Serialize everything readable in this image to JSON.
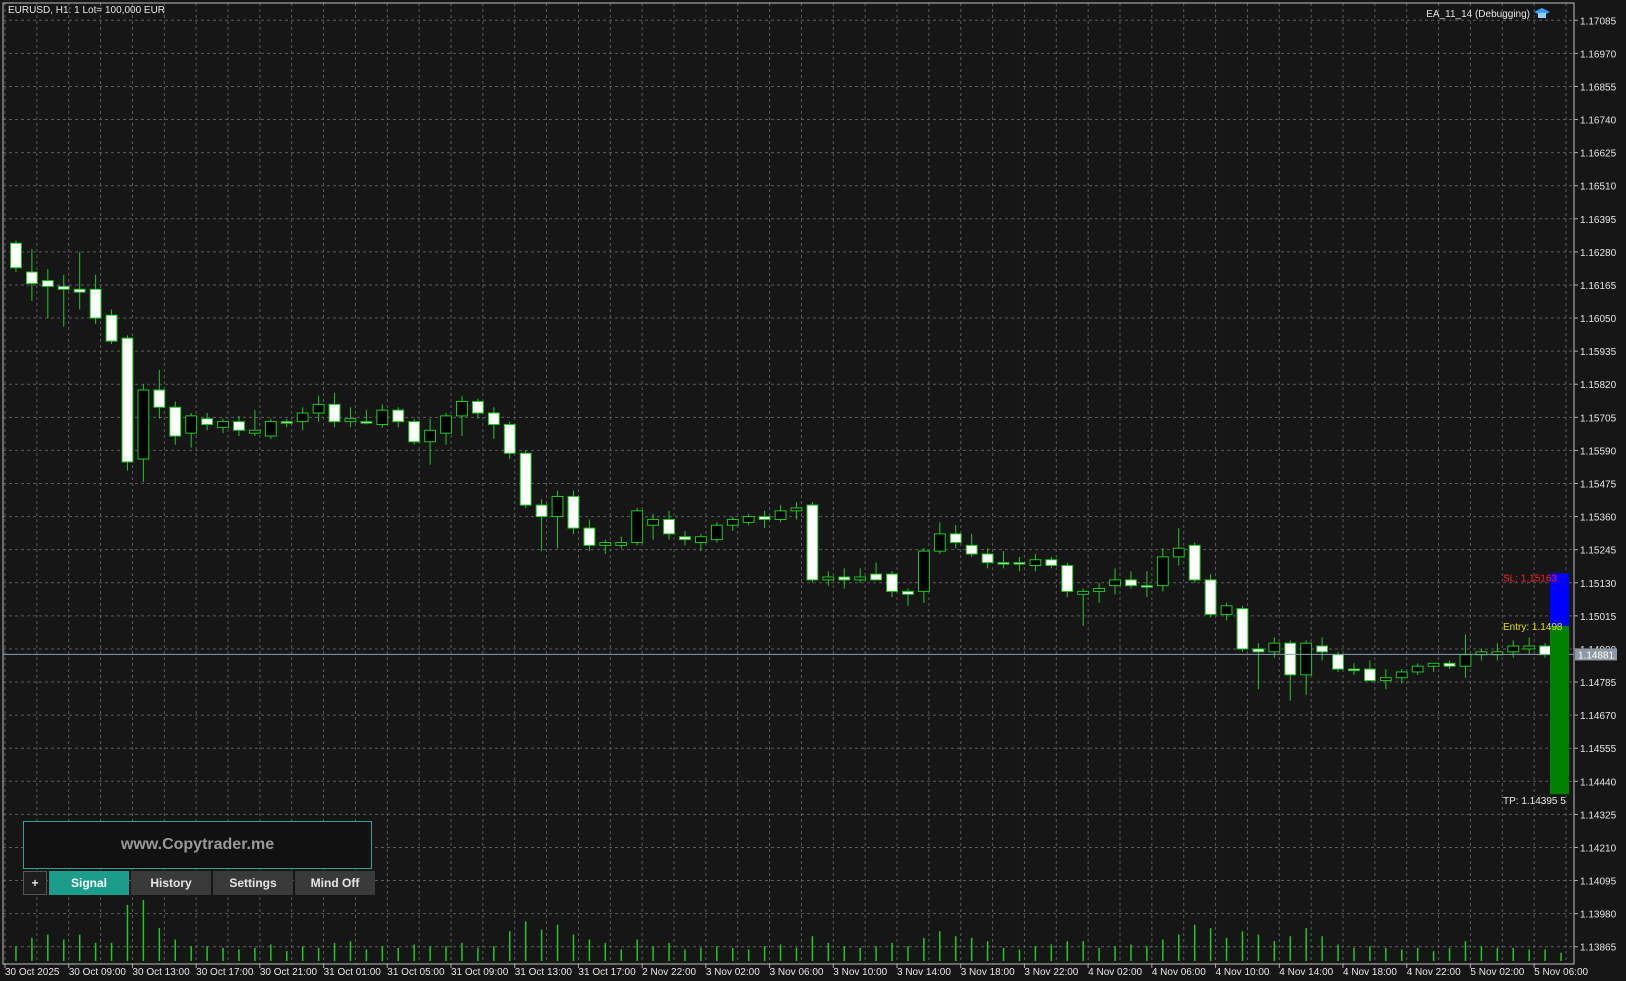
{
  "header": {
    "symbol_info": "EURUSD, H1:  1 Lot= 100,000 EUR",
    "ea_label": "EA_11_14 (Debugging)",
    "ea_icon": "graduation-cap-icon"
  },
  "panel": {
    "title": "www.Copytrader.me",
    "buttons": {
      "plus": "+",
      "signal": "Signal",
      "history": "History",
      "settings": "Settings",
      "mind": "Mind Off"
    }
  },
  "trade": {
    "sl_label": "SL: 1.15163",
    "entry_label": "Entry: 1.1498",
    "tp_label": "TP: 1.14395 5",
    "current_price_label": "1.14881",
    "sl": 1.15163,
    "entry": 1.1498,
    "tp": 1.14395,
    "current_price": 1.14881
  },
  "colors": {
    "background": "#161616",
    "grid": "#5b5b5b",
    "bull_candle": "#000000",
    "bear_candle": "#ffffff",
    "wick": "#22c722",
    "volume": "#22c722",
    "panel_border": "#2fa38f",
    "signal_button": "#1a9d8a",
    "sl_box": "#0000ff",
    "tp_box": "#008000",
    "sl_text": "#ff2020",
    "entry_text": "#e0e000",
    "tp_text": "#e6e6e6",
    "price_line": "#8aa0b0"
  },
  "chart_data": {
    "type": "candlestick",
    "timeframe": "H1",
    "y_ticks": [
      "1.17085",
      "1.16970",
      "1.16855",
      "1.16740",
      "1.16625",
      "1.16510",
      "1.16395",
      "1.16280",
      "1.16165",
      "1.16050",
      "1.15935",
      "1.15820",
      "1.15705",
      "1.15590",
      "1.15475",
      "1.15360",
      "1.15245",
      "1.15130",
      "1.15015",
      "1.14900",
      "1.14785",
      "1.14670",
      "1.14555",
      "1.14440",
      "1.14325",
      "1.14210",
      "1.14095",
      "1.13980",
      "1.13865"
    ],
    "ylim": [
      1.13805,
      1.17145
    ],
    "x_ticks": [
      "30 Oct 2025",
      "30 Oct 09:00",
      "30 Oct 13:00",
      "30 Oct 17:00",
      "30 Oct 21:00",
      "31 Oct 01:00",
      "31 Oct 05:00",
      "31 Oct 09:00",
      "31 Oct 13:00",
      "31 Oct 17:00",
      "2 Nov 22:00",
      "3 Nov 02:00",
      "3 Nov 06:00",
      "3 Nov 10:00",
      "3 Nov 14:00",
      "3 Nov 18:00",
      "3 Nov 22:00",
      "4 Nov 02:00",
      "4 Nov 06:00",
      "4 Nov 10:00",
      "4 Nov 14:00",
      "4 Nov 18:00",
      "4 Nov 22:00",
      "5 Nov 02:00",
      "5 Nov 06:00"
    ],
    "candles": [
      {
        "o": 1.1631,
        "h": 1.1632,
        "l": 1.1621,
        "c": 1.16225,
        "v": 9
      },
      {
        "o": 1.1621,
        "h": 1.1629,
        "l": 1.1611,
        "c": 1.1617,
        "v": 14
      },
      {
        "o": 1.1618,
        "h": 1.1622,
        "l": 1.1605,
        "c": 1.1616,
        "v": 16
      },
      {
        "o": 1.1616,
        "h": 1.162,
        "l": 1.1602,
        "c": 1.1615,
        "v": 13
      },
      {
        "o": 1.1615,
        "h": 1.1628,
        "l": 1.1608,
        "c": 1.1614,
        "v": 16
      },
      {
        "o": 1.1615,
        "h": 1.162,
        "l": 1.1603,
        "c": 1.1605,
        "v": 11
      },
      {
        "o": 1.1606,
        "h": 1.1608,
        "l": 1.1596,
        "c": 1.1597,
        "v": 11
      },
      {
        "o": 1.1598,
        "h": 1.1599,
        "l": 1.1552,
        "c": 1.1555,
        "v": 34
      },
      {
        "o": 1.1556,
        "h": 1.1582,
        "l": 1.1548,
        "c": 1.158,
        "v": 37
      },
      {
        "o": 1.158,
        "h": 1.1587,
        "l": 1.157,
        "c": 1.1574,
        "v": 20
      },
      {
        "o": 1.1574,
        "h": 1.1576,
        "l": 1.1561,
        "c": 1.1564,
        "v": 13
      },
      {
        "o": 1.1565,
        "h": 1.1572,
        "l": 1.156,
        "c": 1.1571,
        "v": 9
      },
      {
        "o": 1.157,
        "h": 1.1572,
        "l": 1.1566,
        "c": 1.1568,
        "v": 9
      },
      {
        "o": 1.1567,
        "h": 1.157,
        "l": 1.1565,
        "c": 1.1569,
        "v": 8
      },
      {
        "o": 1.1569,
        "h": 1.1571,
        "l": 1.1564,
        "c": 1.1566,
        "v": 7
      },
      {
        "o": 1.1565,
        "h": 1.1573,
        "l": 1.1564,
        "c": 1.1566,
        "v": 8
      },
      {
        "o": 1.1564,
        "h": 1.157,
        "l": 1.1563,
        "c": 1.1569,
        "v": 10
      },
      {
        "o": 1.1569,
        "h": 1.157,
        "l": 1.1567,
        "c": 1.1569,
        "v": 6
      },
      {
        "o": 1.1569,
        "h": 1.1574,
        "l": 1.1566,
        "c": 1.1572,
        "v": 9
      },
      {
        "o": 1.1572,
        "h": 1.1578,
        "l": 1.1569,
        "c": 1.1575,
        "v": 8
      },
      {
        "o": 1.1575,
        "h": 1.1579,
        "l": 1.1567,
        "c": 1.1569,
        "v": 11
      },
      {
        "o": 1.1569,
        "h": 1.1574,
        "l": 1.1567,
        "c": 1.157,
        "v": 12
      },
      {
        "o": 1.1569,
        "h": 1.1573,
        "l": 1.1568,
        "c": 1.1569,
        "v": 7
      },
      {
        "o": 1.1568,
        "h": 1.1575,
        "l": 1.1567,
        "c": 1.1573,
        "v": 9
      },
      {
        "o": 1.1573,
        "h": 1.1574,
        "l": 1.1567,
        "c": 1.1569,
        "v": 8
      },
      {
        "o": 1.1569,
        "h": 1.157,
        "l": 1.1561,
        "c": 1.1562,
        "v": 10
      },
      {
        "o": 1.1562,
        "h": 1.157,
        "l": 1.1554,
        "c": 1.1566,
        "v": 9
      },
      {
        "o": 1.1565,
        "h": 1.1572,
        "l": 1.1561,
        "c": 1.1571,
        "v": 9
      },
      {
        "o": 1.1571,
        "h": 1.1578,
        "l": 1.1564,
        "c": 1.1576,
        "v": 11
      },
      {
        "o": 1.1576,
        "h": 1.1577,
        "l": 1.157,
        "c": 1.1572,
        "v": 8
      },
      {
        "o": 1.1572,
        "h": 1.1574,
        "l": 1.1563,
        "c": 1.1568,
        "v": 9
      },
      {
        "o": 1.1568,
        "h": 1.1569,
        "l": 1.1556,
        "c": 1.1558,
        "v": 18
      },
      {
        "o": 1.1558,
        "h": 1.1559,
        "l": 1.1539,
        "c": 1.154,
        "v": 24
      },
      {
        "o": 1.154,
        "h": 1.1542,
        "l": 1.1524,
        "c": 1.1536,
        "v": 19
      },
      {
        "o": 1.1536,
        "h": 1.1545,
        "l": 1.1525,
        "c": 1.1543,
        "v": 22
      },
      {
        "o": 1.1543,
        "h": 1.1545,
        "l": 1.153,
        "c": 1.1532,
        "v": 16
      },
      {
        "o": 1.1532,
        "h": 1.1535,
        "l": 1.1524,
        "c": 1.1526,
        "v": 13
      },
      {
        "o": 1.1526,
        "h": 1.1528,
        "l": 1.1523,
        "c": 1.1527,
        "v": 11
      },
      {
        "o": 1.1526,
        "h": 1.1529,
        "l": 1.1525,
        "c": 1.1527,
        "v": 7
      },
      {
        "o": 1.1527,
        "h": 1.1539,
        "l": 1.1526,
        "c": 1.1538,
        "v": 13
      },
      {
        "o": 1.1533,
        "h": 1.1537,
        "l": 1.1528,
        "c": 1.1535,
        "v": 9
      },
      {
        "o": 1.1535,
        "h": 1.1538,
        "l": 1.1528,
        "c": 1.153,
        "v": 11
      },
      {
        "o": 1.1529,
        "h": 1.1531,
        "l": 1.1526,
        "c": 1.1528,
        "v": 7
      },
      {
        "o": 1.1527,
        "h": 1.153,
        "l": 1.1524,
        "c": 1.1529,
        "v": 8
      },
      {
        "o": 1.1528,
        "h": 1.1534,
        "l": 1.1527,
        "c": 1.1533,
        "v": 9
      },
      {
        "o": 1.1533,
        "h": 1.1536,
        "l": 1.1531,
        "c": 1.1535,
        "v": 8
      },
      {
        "o": 1.1534,
        "h": 1.1537,
        "l": 1.1533,
        "c": 1.1536,
        "v": 7
      },
      {
        "o": 1.1536,
        "h": 1.1538,
        "l": 1.1532,
        "c": 1.1535,
        "v": 9
      },
      {
        "o": 1.1535,
        "h": 1.154,
        "l": 1.1534,
        "c": 1.1538,
        "v": 10
      },
      {
        "o": 1.1538,
        "h": 1.1541,
        "l": 1.1535,
        "c": 1.1539,
        "v": 8
      },
      {
        "o": 1.154,
        "h": 1.1541,
        "l": 1.1513,
        "c": 1.1514,
        "v": 15
      },
      {
        "o": 1.1514,
        "h": 1.1517,
        "l": 1.1512,
        "c": 1.1515,
        "v": 11
      },
      {
        "o": 1.1515,
        "h": 1.1518,
        "l": 1.1511,
        "c": 1.1514,
        "v": 9
      },
      {
        "o": 1.1514,
        "h": 1.1518,
        "l": 1.1513,
        "c": 1.1515,
        "v": 8
      },
      {
        "o": 1.1516,
        "h": 1.152,
        "l": 1.1514,
        "c": 1.1514,
        "v": 9
      },
      {
        "o": 1.1516,
        "h": 1.1517,
        "l": 1.1508,
        "c": 1.151,
        "v": 11
      },
      {
        "o": 1.151,
        "h": 1.1511,
        "l": 1.1505,
        "c": 1.1509,
        "v": 9
      },
      {
        "o": 1.151,
        "h": 1.1525,
        "l": 1.1506,
        "c": 1.1524,
        "v": 14
      },
      {
        "o": 1.1524,
        "h": 1.1534,
        "l": 1.1523,
        "c": 1.153,
        "v": 18
      },
      {
        "o": 1.153,
        "h": 1.1533,
        "l": 1.1525,
        "c": 1.1527,
        "v": 15
      },
      {
        "o": 1.1526,
        "h": 1.153,
        "l": 1.1522,
        "c": 1.1523,
        "v": 14
      },
      {
        "o": 1.1523,
        "h": 1.1525,
        "l": 1.1518,
        "c": 1.152,
        "v": 12
      },
      {
        "o": 1.152,
        "h": 1.1524,
        "l": 1.1518,
        "c": 1.152,
        "v": 8
      },
      {
        "o": 1.152,
        "h": 1.1522,
        "l": 1.1517,
        "c": 1.152,
        "v": 7
      },
      {
        "o": 1.1519,
        "h": 1.1523,
        "l": 1.1517,
        "c": 1.1521,
        "v": 9
      },
      {
        "o": 1.1521,
        "h": 1.1522,
        "l": 1.1518,
        "c": 1.1519,
        "v": 10
      },
      {
        "o": 1.1519,
        "h": 1.152,
        "l": 1.1508,
        "c": 1.151,
        "v": 12
      },
      {
        "o": 1.1509,
        "h": 1.1511,
        "l": 1.1498,
        "c": 1.151,
        "v": 12
      },
      {
        "o": 1.151,
        "h": 1.1513,
        "l": 1.1506,
        "c": 1.1511,
        "v": 8
      },
      {
        "o": 1.1512,
        "h": 1.1518,
        "l": 1.1509,
        "c": 1.1514,
        "v": 9
      },
      {
        "o": 1.1514,
        "h": 1.1517,
        "l": 1.1511,
        "c": 1.1512,
        "v": 10
      },
      {
        "o": 1.1512,
        "h": 1.1517,
        "l": 1.1508,
        "c": 1.1512,
        "v": 9
      },
      {
        "o": 1.1512,
        "h": 1.1525,
        "l": 1.151,
        "c": 1.1522,
        "v": 13
      },
      {
        "o": 1.1522,
        "h": 1.1532,
        "l": 1.1519,
        "c": 1.1525,
        "v": 16
      },
      {
        "o": 1.1526,
        "h": 1.1527,
        "l": 1.1513,
        "c": 1.1514,
        "v": 22
      },
      {
        "o": 1.1514,
        "h": 1.1516,
        "l": 1.1501,
        "c": 1.1502,
        "v": 20
      },
      {
        "o": 1.1502,
        "h": 1.1506,
        "l": 1.15,
        "c": 1.1505,
        "v": 14
      },
      {
        "o": 1.1504,
        "h": 1.1505,
        "l": 1.1489,
        "c": 1.149,
        "v": 18
      },
      {
        "o": 1.149,
        "h": 1.1492,
        "l": 1.1476,
        "c": 1.1489,
        "v": 16
      },
      {
        "o": 1.1489,
        "h": 1.1494,
        "l": 1.1487,
        "c": 1.1492,
        "v": 12
      },
      {
        "o": 1.1492,
        "h": 1.1493,
        "l": 1.1472,
        "c": 1.1481,
        "v": 15
      },
      {
        "o": 1.1481,
        "h": 1.1493,
        "l": 1.1474,
        "c": 1.1492,
        "v": 20
      },
      {
        "o": 1.1491,
        "h": 1.1494,
        "l": 1.1486,
        "c": 1.1489,
        "v": 15
      },
      {
        "o": 1.1488,
        "h": 1.1489,
        "l": 1.1482,
        "c": 1.1483,
        "v": 10
      },
      {
        "o": 1.1483,
        "h": 1.1485,
        "l": 1.1481,
        "c": 1.1483,
        "v": 8
      },
      {
        "o": 1.1483,
        "h": 1.1486,
        "l": 1.1479,
        "c": 1.1479,
        "v": 9
      },
      {
        "o": 1.1479,
        "h": 1.1483,
        "l": 1.1476,
        "c": 1.148,
        "v": 8
      },
      {
        "o": 1.148,
        "h": 1.1483,
        "l": 1.1478,
        "c": 1.1482,
        "v": 7
      },
      {
        "o": 1.1482,
        "h": 1.1485,
        "l": 1.1481,
        "c": 1.1484,
        "v": 8
      },
      {
        "o": 1.1484,
        "h": 1.1485,
        "l": 1.1482,
        "c": 1.1485,
        "v": 6
      },
      {
        "o": 1.1485,
        "h": 1.1486,
        "l": 1.1483,
        "c": 1.1484,
        "v": 8
      },
      {
        "o": 1.1484,
        "h": 1.1495,
        "l": 1.148,
        "c": 1.1488,
        "v": 12
      },
      {
        "o": 1.1488,
        "h": 1.149,
        "l": 1.1486,
        "c": 1.1489,
        "v": 9
      },
      {
        "o": 1.1488,
        "h": 1.1492,
        "l": 1.1486,
        "c": 1.1489,
        "v": 8
      },
      {
        "o": 1.1489,
        "h": 1.1493,
        "l": 1.1487,
        "c": 1.1491,
        "v": 8
      },
      {
        "o": 1.149,
        "h": 1.1494,
        "l": 1.1488,
        "c": 1.1491,
        "v": 7
      },
      {
        "o": 1.1491,
        "h": 1.1492,
        "l": 1.1487,
        "c": 1.1488,
        "v": 7
      },
      {
        "o": 1.1488,
        "h": 1.149,
        "l": 1.1487,
        "c": 1.1488,
        "v": 5
      }
    ]
  }
}
